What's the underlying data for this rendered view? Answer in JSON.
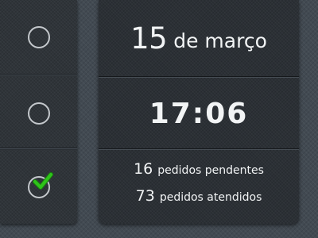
{
  "tasks": [
    {
      "checked": false,
      "icon": "empty-circle"
    },
    {
      "checked": false,
      "icon": "empty-circle"
    },
    {
      "checked": true,
      "icon": "checkmark",
      "check_color": "#2ec41a"
    }
  ],
  "date": {
    "day": "15",
    "month_text": "de março"
  },
  "time": "17:06",
  "orders": {
    "pending_count": "16",
    "pending_label": "pedidos pendentes",
    "completed_count": "73",
    "completed_label": "pedidos atendidos"
  },
  "colors": {
    "background": "#424a52",
    "panel": "#2b3035",
    "text": "#f2f4f5",
    "circle": "#c4c8cc",
    "check": "#2ec41a"
  }
}
